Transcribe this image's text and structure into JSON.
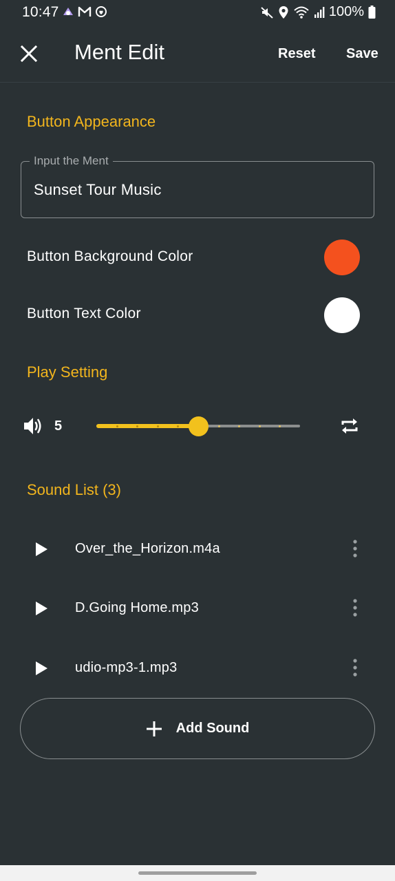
{
  "status_bar": {
    "time": "10:47",
    "battery": "100%",
    "left_icons": [
      "notification-app-icon",
      "gmail-icon",
      "security-icon"
    ],
    "right_icons": [
      "mute-icon",
      "location-icon",
      "wifi-icon",
      "signal-icon",
      "battery-icon"
    ]
  },
  "app_bar": {
    "title": "Ment Edit",
    "reset_label": "Reset",
    "save_label": "Save",
    "close_icon": "close-icon"
  },
  "button_appearance": {
    "section_title": "Button Appearance",
    "ment_field": {
      "label": "Input the Ment",
      "value": "Sunset Tour Music"
    },
    "background_color": {
      "label": "Button Background Color",
      "color": "#f4511e"
    },
    "text_color": {
      "label": "Button Text Color",
      "color": "#ffffff"
    }
  },
  "play_setting": {
    "section_title": "Play Setting",
    "volume": {
      "value": "5",
      "min": 0,
      "max": 10,
      "level": 5
    },
    "repeat_icon": "repeat-icon"
  },
  "sound_list": {
    "section_title": "Sound List (3)",
    "items": [
      {
        "name": "Over_the_Horizon.m4a"
      },
      {
        "name": "D.Going Home.mp3"
      },
      {
        "name": "udio-mp3-1.mp3"
      }
    ],
    "add_label": "Add Sound"
  },
  "colors": {
    "background": "#2a3134",
    "accent": "#f2b51d",
    "slider": "#f2c11d"
  }
}
